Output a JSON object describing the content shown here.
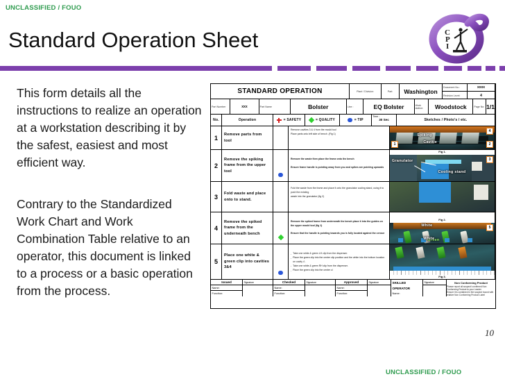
{
  "classification": {
    "level": "UNCLASSIFIED",
    "separator": "/",
    "caveat": "FOUO"
  },
  "slide": {
    "title": "Standard Operation Sheet",
    "page_number": "10",
    "paragraph_1": "This form details all the instructions to realize an operation at a workstation describing it by the safest, easiest and most efficient way.",
    "paragraph_2": "Contrary to the Standardized Work Chart and Work Combination Table relative to an operator, this document is linked to a process or a basic operation from the process.",
    "accent_color": "#7c3fac",
    "classification_color": "#2e9b4e"
  },
  "logo": {
    "name": "cpi-logo",
    "letter": "O",
    "initials": "CPI"
  },
  "form": {
    "title": "STANDARD OPERATION",
    "header": {
      "plant_label": "Plant / Division:",
      "part_label": "Part:",
      "plant_value": "Washington",
      "document_no_label": "Document No.:",
      "document_no_value": "xxxx",
      "revision_label": "Revision Level:",
      "revision_value": "4",
      "part_number_label": "Part Number",
      "part_number_value": "xxx",
      "part_name_label": "Part Name",
      "part_name_value": "Bolster",
      "line_label": "Line :",
      "line_value": "EQ Bolster",
      "workstation_label": "Work station:",
      "workstation_value": "Woodstock",
      "page_label": "Page No:",
      "page_value": "1/1"
    },
    "columns": {
      "no": "No.",
      "operation": "Operation",
      "safety": "= SAFETY",
      "quality": "= QUALITY",
      "tip": "= TIP",
      "time_label": "Time :",
      "time_value": "30 Sec",
      "sketches": "Sketches / Photo's / etc."
    },
    "symbols": {
      "safety": "red-cross-icon",
      "quality": "green-diamond-icon",
      "tip": "blue-dot-icon"
    },
    "rows": [
      {
        "no": "1",
        "operation": "Remove parts from tool",
        "symbol": "",
        "details": [
          {
            "text": "Remove cavities 3 & 4 from the mould tool",
            "bold": false,
            "symbol": ""
          },
          {
            "text": "Place parts onto left side of bench .(Fig 1)",
            "bold": false,
            "symbol": ""
          }
        ]
      },
      {
        "no": "2",
        "operation": "Remove the spiking frame from the upper tool",
        "symbol": "tip",
        "details": [
          {
            "text": "Remove the waste then  place the frame onto the bench",
            "bold": true,
            "symbol": ""
          },
          {
            "text": "Ensure frame handle is pointing away from you and spikes are pointing upwards",
            "bold": true,
            "symbol": "tip"
          }
        ]
      },
      {
        "no": "3",
        "operation": "Fold waste and place onto to stand.",
        "symbol": "",
        "details": [
          {
            "text": "Fold the waste from the frame and place it onto the granulator cooling stand, using it to push the existing",
            "bold": false,
            "symbol": ""
          },
          {
            "text": "waste into the granulator (fig 2)",
            "bold": false,
            "symbol": ""
          }
        ]
      },
      {
        "no": "4",
        "operation": "Remove the spiked frame from the underneath  bench",
        "symbol": "quality",
        "details": [
          {
            "text": "Remove the spiked frame from underneath the bench  place it into the guides on the upper mould tool (fig 1)",
            "bold": true,
            "symbol": ""
          },
          {
            "text": "Ensure that the  handle is pointing towards you  is fully located against the censor",
            "bold": true,
            "symbol": "quality"
          }
        ]
      },
      {
        "no": "5",
        "operation": "Place one white & green clip into cavities 3&4",
        "symbol": "tip",
        "details": [
          {
            "text": "Take one white & green LH clip from the dispenser.",
            "bold": false,
            "symbol": ""
          },
          {
            "text": "Place the green clip into the center clip position and the white into the bottom location on cavity 4 .",
            "bold": false,
            "symbol": ""
          },
          {
            "text": "Take one white & green RH clip from the dispenser.",
            "bold": false,
            "symbol": ""
          },
          {
            "text": "Place the green clip into the center cl",
            "bold": false,
            "symbol": ""
          }
        ]
      }
    ],
    "photos": [
      {
        "name": "photo-mould-tool",
        "caption": "Fig 1.",
        "labels": [
          "Spiking",
          "Cavitie"
        ],
        "markers": [
          "4",
          "1",
          "2"
        ]
      },
      {
        "name": "photo-granulator",
        "caption": "Fig 2.",
        "labels": [
          "Granulator",
          "Cooling stand"
        ],
        "markers": [
          "3"
        ]
      },
      {
        "name": "photo-clips",
        "caption": "Fig 3.",
        "labels": [
          "White",
          "Green",
          "White"
        ],
        "markers": [
          "5"
        ]
      }
    ],
    "footer": {
      "issued_label": "Issued",
      "checked_label": "Checked",
      "approved_label": "Approved",
      "signature_label": "Signature",
      "name_label": "Name:",
      "function_label": "Function:",
      "skilled_line_1": "SKILLED",
      "skilled_line_2": "OPERATOR",
      "ncp_title": "Non Conforming Product",
      "ncp_line_1": "Please report all suspect/ confirmed  Non Conforming Product to your Leader",
      "ncp_line_2": "Ensure it is contained in the suspect  bound with relative Non Conforming Product  Label"
    }
  }
}
